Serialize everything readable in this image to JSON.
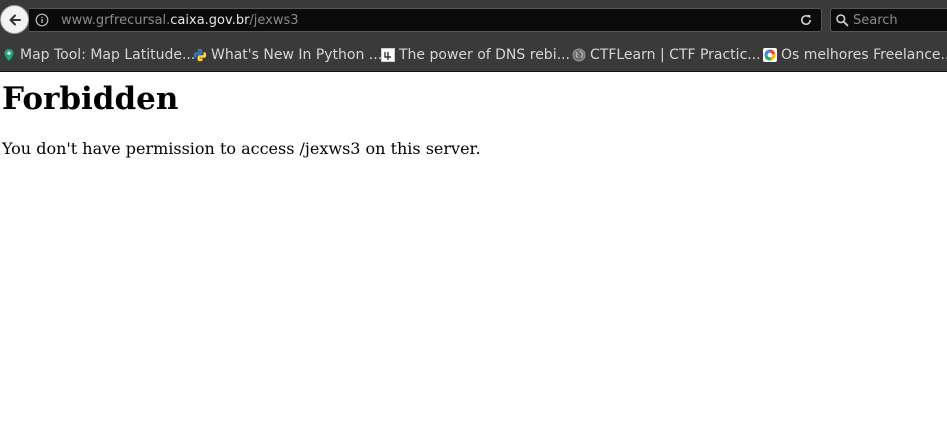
{
  "toolbar": {
    "url": {
      "prefix": "www.grfrecursal.",
      "domain": "caixa.gov.br",
      "path": "/jexws3"
    },
    "search": {
      "placeholder": "Search"
    }
  },
  "bookmarks": [
    {
      "label": "Map Tool: Map Latitude...",
      "icon": "map-pin-icon",
      "color": "#1fa67a"
    },
    {
      "label": "What's New In Python ...",
      "icon": "python-icon",
      "color": "#3776ab"
    },
    {
      "label": "The power of DNS rebi...",
      "icon": "page-icon",
      "color": "#ffffff"
    },
    {
      "label": "CTFLearn | CTF Practic...",
      "icon": "globe-icon",
      "color": "#9a9a9a"
    },
    {
      "label": "Os melhores Freelance...",
      "icon": "colorful-logo-icon",
      "color": "#e94235"
    }
  ],
  "page": {
    "heading": "Forbidden",
    "message": "You don't have permission to access /jexws3 on this server."
  }
}
